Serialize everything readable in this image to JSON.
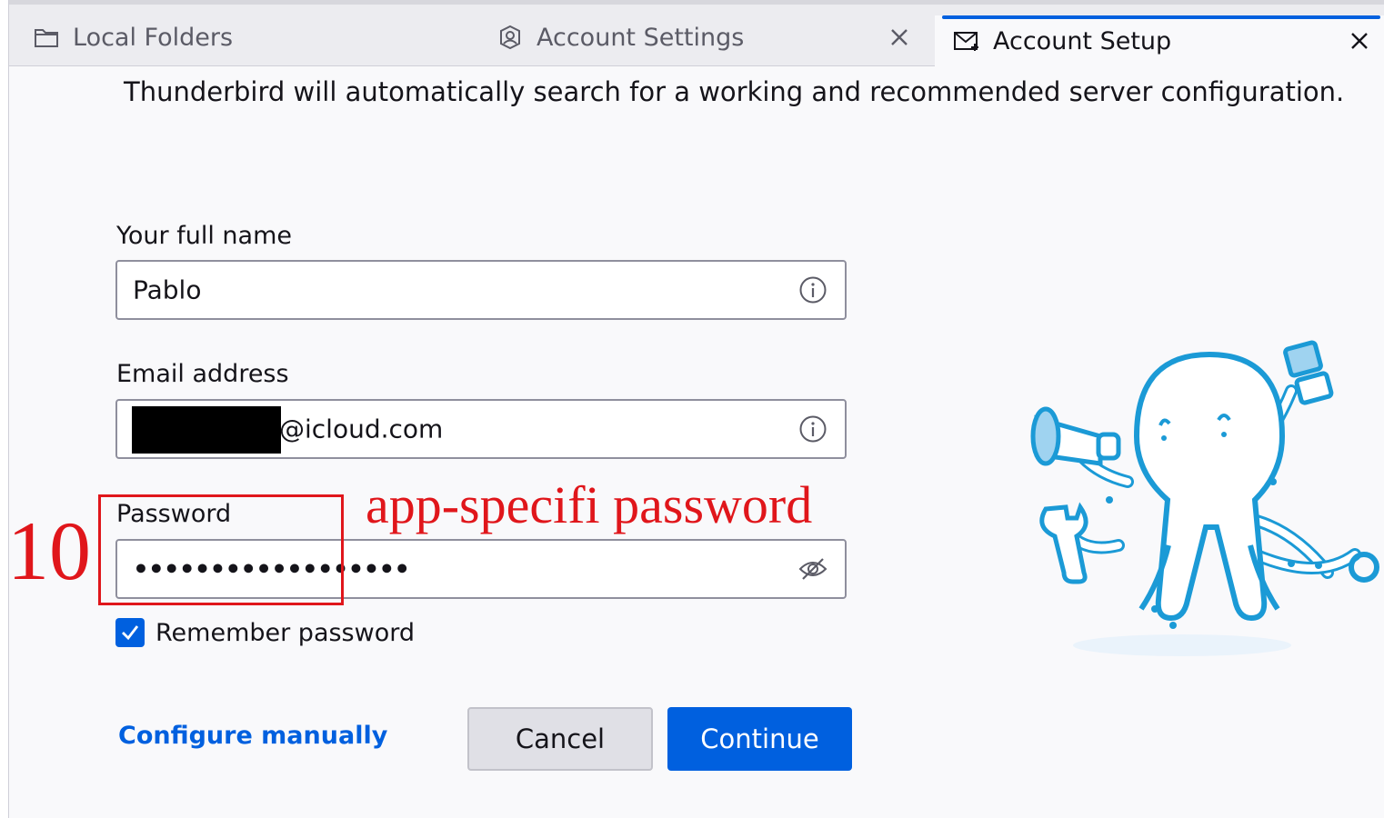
{
  "tabs": [
    {
      "label": "Local Folders",
      "icon": "folder-icon",
      "active": false
    },
    {
      "label": "Account Settings",
      "icon": "account-settings-icon",
      "active": false,
      "closable": true
    },
    {
      "label": "Account Setup",
      "icon": "mail-setup-icon",
      "active": true,
      "closable": true
    }
  ],
  "intro": "Thunderbird will automatically search for a working and recommended server configuration.",
  "form": {
    "full_name": {
      "label": "Your full name",
      "value": "Pablo",
      "icon": "info-icon"
    },
    "email": {
      "label": "Email address",
      "value_visible": "@icloud.com",
      "icon": "info-icon"
    },
    "password": {
      "label": "Password",
      "value": "••••••••••••••••••",
      "icon": "eye-slash-icon"
    },
    "remember": {
      "label": "Remember password",
      "checked": true
    }
  },
  "actions": {
    "configure_manually": "Configure manually",
    "cancel": "Cancel",
    "continue": "Continue"
  },
  "annotation": {
    "step_number": "10",
    "note": "app-specifi password",
    "color": "#e0161b"
  },
  "colors": {
    "accent": "#0060df",
    "background": "#f9f9fb"
  }
}
